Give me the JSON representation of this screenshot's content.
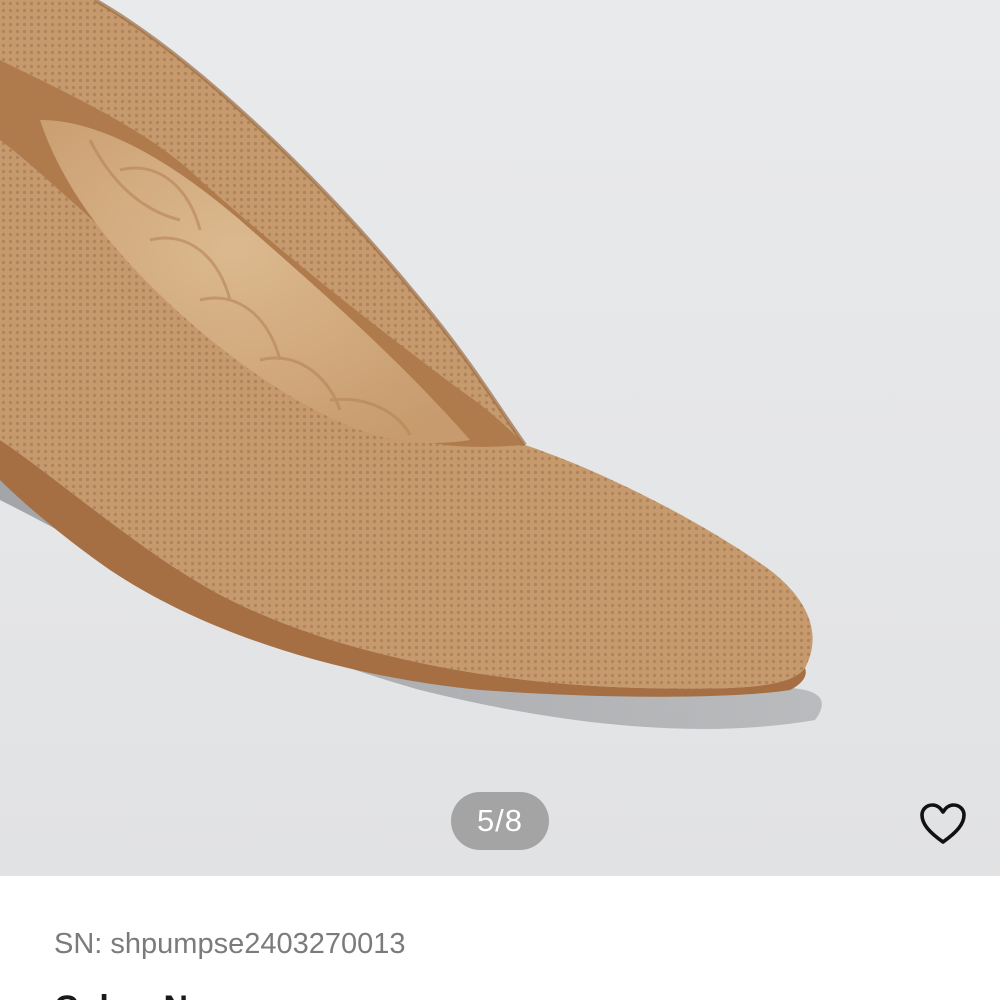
{
  "gallery": {
    "image_alt": "shoe-product-photo",
    "current_page": 5,
    "total_pages": 8,
    "indicator_text": "5/8"
  },
  "actions": {
    "favorite_icon": "heart-outline-icon"
  },
  "product": {
    "sn_text": "SN: shpumpse2403270013",
    "title_partial": "Color: Na"
  },
  "colors": {
    "background": "#e6e7e9",
    "shoe_knit": "#c4976a",
    "insole": "#d4ae84",
    "indicator_bg": "#8c8c8c",
    "text_muted": "#7b7b7b"
  }
}
